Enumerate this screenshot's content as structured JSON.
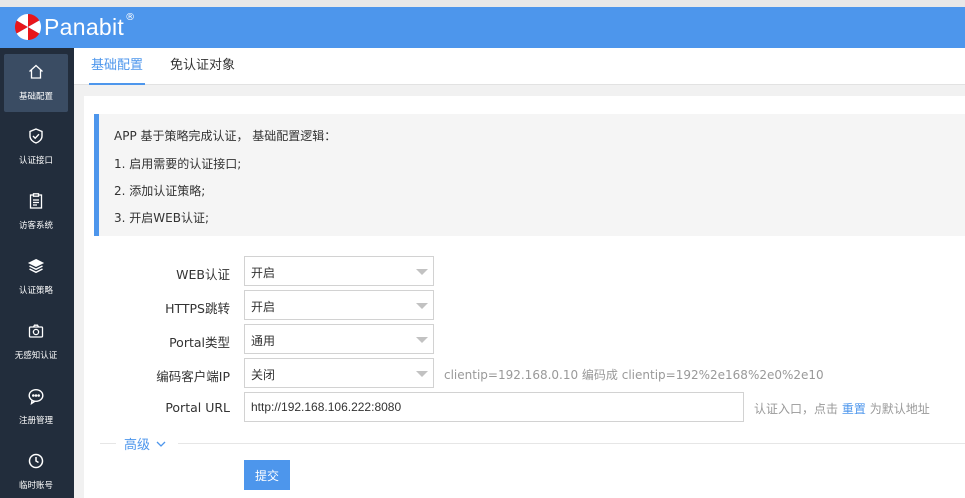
{
  "brand": {
    "name": "Panabit",
    "reg_mark": "®"
  },
  "colors": {
    "accent": "#4d96ec",
    "sidebar": "#222d3c",
    "sidebar_active": "#3a4c63",
    "logo_red": "#e8161b"
  },
  "sidebar": {
    "items": [
      {
        "label": "基础配置",
        "icon": "home-icon",
        "active": true
      },
      {
        "label": "认证接口",
        "icon": "shield-check-icon"
      },
      {
        "label": "访客系统",
        "icon": "clipboard-icon"
      },
      {
        "label": "认证策略",
        "icon": "layers-icon"
      },
      {
        "label": "无感知认证",
        "icon": "camera-icon"
      },
      {
        "label": "注册管理",
        "icon": "chat-icon"
      },
      {
        "label": "临时账号",
        "icon": "clock-icon"
      }
    ]
  },
  "tabs": [
    {
      "label": "基础配置",
      "active": true
    },
    {
      "label": "免认证对象"
    }
  ],
  "info": {
    "lines": [
      "APP 基于策略完成认证， 基础配置逻辑：",
      "1. 启用需要的认证接口;",
      "2. 添加认证策略;",
      "3. 开启WEB认证;"
    ]
  },
  "form": {
    "web_auth": {
      "label": "WEB认证",
      "value": "开启"
    },
    "https_redirect": {
      "label": "HTTPS跳转",
      "value": "开启"
    },
    "portal_type": {
      "label": "Portal类型",
      "value": "通用"
    },
    "encode_ip": {
      "label": "编码客户端IP",
      "value": "关闭",
      "hint": "clientip=192.168.0.10 编码成 clientip=192%2e168%2e0%2e10"
    },
    "portal_url": {
      "label": "Portal URL",
      "value": "http://192.168.106.222:8080",
      "hint_prefix": "认证入口，点击",
      "hint_link": "重置",
      "hint_suffix": "为默认地址"
    },
    "advanced_label": "高级",
    "submit_label": "提交"
  }
}
